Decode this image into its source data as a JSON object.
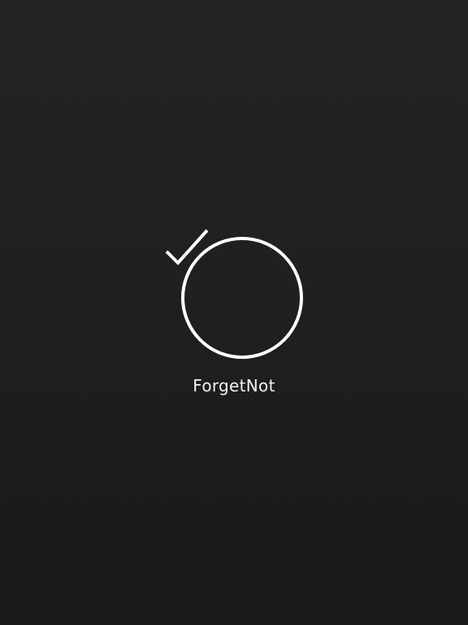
{
  "splash": {
    "app_name": "ForgetNot",
    "logo_icon": "checkmark-circle-icon",
    "background_color": "#1f2020",
    "foreground_color": "#ffffff"
  }
}
